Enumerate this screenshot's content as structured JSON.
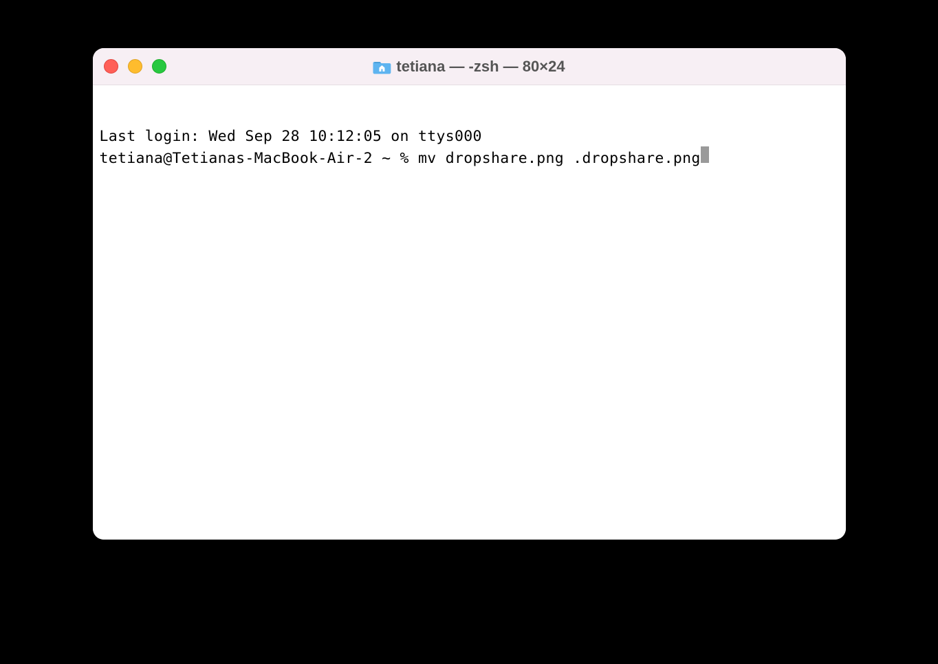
{
  "titlebar": {
    "title": "tetiana — -zsh — 80×24",
    "folder_icon": "home-folder-icon"
  },
  "traffic_lights": {
    "close": "close",
    "minimize": "minimize",
    "maximize": "maximize"
  },
  "terminal": {
    "last_login_line": "Last login: Wed Sep 28 10:12:05 on ttys000",
    "prompt": "tetiana@Tetianas-MacBook-Air-2 ~ % ",
    "command": "mv dropshare.png .dropshare.png"
  }
}
